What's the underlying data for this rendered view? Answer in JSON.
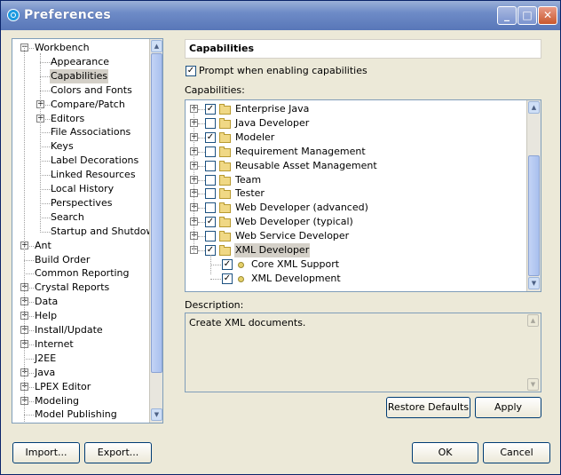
{
  "window": {
    "title": "Preferences",
    "min": "_",
    "max": "□",
    "close": "✕"
  },
  "left_tree": [
    {
      "label": "Workbench",
      "level": 0,
      "expander": "−"
    },
    {
      "label": "Appearance",
      "level": 1,
      "expander": ""
    },
    {
      "label": "Capabilities",
      "level": 1,
      "expander": "",
      "selected": true
    },
    {
      "label": "Colors and Fonts",
      "level": 1,
      "expander": ""
    },
    {
      "label": "Compare/Patch",
      "level": 1,
      "expander": "+"
    },
    {
      "label": "Editors",
      "level": 1,
      "expander": "+"
    },
    {
      "label": "File Associations",
      "level": 1,
      "expander": ""
    },
    {
      "label": "Keys",
      "level": 1,
      "expander": ""
    },
    {
      "label": "Label Decorations",
      "level": 1,
      "expander": ""
    },
    {
      "label": "Linked Resources",
      "level": 1,
      "expander": ""
    },
    {
      "label": "Local History",
      "level": 1,
      "expander": ""
    },
    {
      "label": "Perspectives",
      "level": 1,
      "expander": ""
    },
    {
      "label": "Search",
      "level": 1,
      "expander": ""
    },
    {
      "label": "Startup and Shutdown",
      "level": 1,
      "expander": ""
    },
    {
      "label": "Ant",
      "level": 0,
      "expander": "+"
    },
    {
      "label": "Build Order",
      "level": 0,
      "expander": ""
    },
    {
      "label": "Common Reporting",
      "level": 0,
      "expander": ""
    },
    {
      "label": "Crystal Reports",
      "level": 0,
      "expander": "+"
    },
    {
      "label": "Data",
      "level": 0,
      "expander": "+"
    },
    {
      "label": "Help",
      "level": 0,
      "expander": "+"
    },
    {
      "label": "Install/Update",
      "level": 0,
      "expander": "+"
    },
    {
      "label": "Internet",
      "level": 0,
      "expander": "+"
    },
    {
      "label": "J2EE",
      "level": 0,
      "expander": ""
    },
    {
      "label": "Java",
      "level": 0,
      "expander": "+"
    },
    {
      "label": "LPEX Editor",
      "level": 0,
      "expander": "+"
    },
    {
      "label": "Modeling",
      "level": 0,
      "expander": "+"
    },
    {
      "label": "Model Publishing",
      "level": 0,
      "expander": ""
    }
  ],
  "page_header": "Capabilities",
  "prompt_checkbox": {
    "label": "Prompt when enabling capabilities",
    "checked": true
  },
  "capabilities_label": "Capabilities:",
  "capabilities": [
    {
      "label": "Enterprise Java",
      "checked": true,
      "expander": "+"
    },
    {
      "label": "Java Developer",
      "checked": false,
      "expander": "+"
    },
    {
      "label": "Modeler",
      "checked": true,
      "expander": "+"
    },
    {
      "label": "Requirement Management",
      "checked": false,
      "expander": "+"
    },
    {
      "label": "Reusable Asset Management",
      "checked": false,
      "expander": "+"
    },
    {
      "label": "Team",
      "checked": false,
      "expander": "+"
    },
    {
      "label": "Tester",
      "checked": false,
      "expander": "+"
    },
    {
      "label": "Web Developer (advanced)",
      "checked": false,
      "expander": "+"
    },
    {
      "label": "Web Developer (typical)",
      "checked": true,
      "expander": "+"
    },
    {
      "label": "Web Service Developer",
      "checked": false,
      "expander": "+"
    },
    {
      "label": "XML Developer",
      "checked": true,
      "expander": "−",
      "selected": true,
      "children": [
        {
          "label": "Core XML Support",
          "checked": true
        },
        {
          "label": "XML Development",
          "checked": true
        }
      ]
    }
  ],
  "description_label": "Description:",
  "description_text": "Create XML documents.",
  "buttons": {
    "restore_defaults": "Restore Defaults",
    "apply": "Apply",
    "import": "Import...",
    "export": "Export...",
    "ok": "OK",
    "cancel": "Cancel"
  },
  "scroll_up": "▲",
  "scroll_down": "▼",
  "check_mark": "✓",
  "colors": {
    "titlebar": "#6e8bc7",
    "dialog_bg": "#ece9d8",
    "border": "#7f9db9",
    "selection": "#d4d0c8"
  }
}
